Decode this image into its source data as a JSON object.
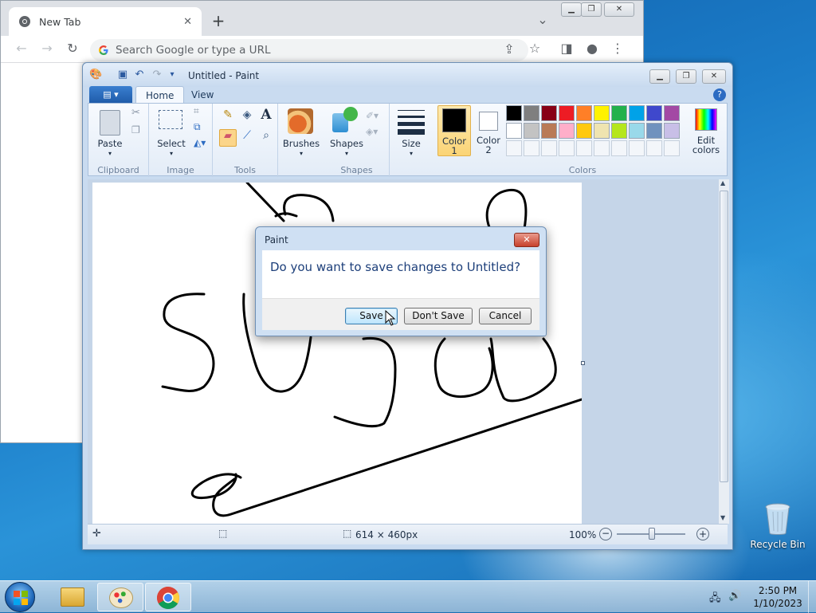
{
  "chrome": {
    "tab_title": "New Tab",
    "tab_close": "✕",
    "new_tab": "+",
    "omnibox_placeholder": "Search Google or type a URL"
  },
  "paint": {
    "window_title": "Untitled - Paint",
    "tabs": [
      "Home",
      "View"
    ],
    "groups": {
      "clipboard": "Clipboard",
      "image": "Image",
      "tools": "Tools",
      "shapes": "Shapes",
      "colors": "Colors"
    },
    "buttons": {
      "paste": "Paste",
      "select": "Select",
      "brushes": "Brushes",
      "shapes": "Shapes",
      "size": "Size",
      "color1_line1": "Color",
      "color1_line2": "1",
      "color2_line1": "Color",
      "color2_line2": "2",
      "edit_colors_line1": "Edit",
      "edit_colors_line2": "colors"
    },
    "palette_row1": [
      "#000000",
      "#7f7f7f",
      "#880015",
      "#ed1c24",
      "#ff7f27",
      "#fff200",
      "#22b14c",
      "#00a2e8",
      "#3f48cc",
      "#a349a4"
    ],
    "palette_row2": [
      "#ffffff",
      "#c3c3c3",
      "#b97a57",
      "#ffaec9",
      "#ffc90e",
      "#efe4b0",
      "#b5e61d",
      "#99d9ea",
      "#7092be",
      "#c8bfe7"
    ],
    "color1": "#000000",
    "color2": "#ffffff",
    "status": {
      "dimensions": "614 × 460px",
      "zoom": "100%"
    }
  },
  "dialog": {
    "title": "Paint",
    "message": "Do you want to save changes to Untitled?",
    "save": "Save",
    "dont_save": "Don't Save",
    "cancel": "Cancel"
  },
  "desktop": {
    "recycle_bin": "Recycle Bin"
  },
  "taskbar": {
    "time": "2:50 PM",
    "date": "1/10/2023"
  }
}
